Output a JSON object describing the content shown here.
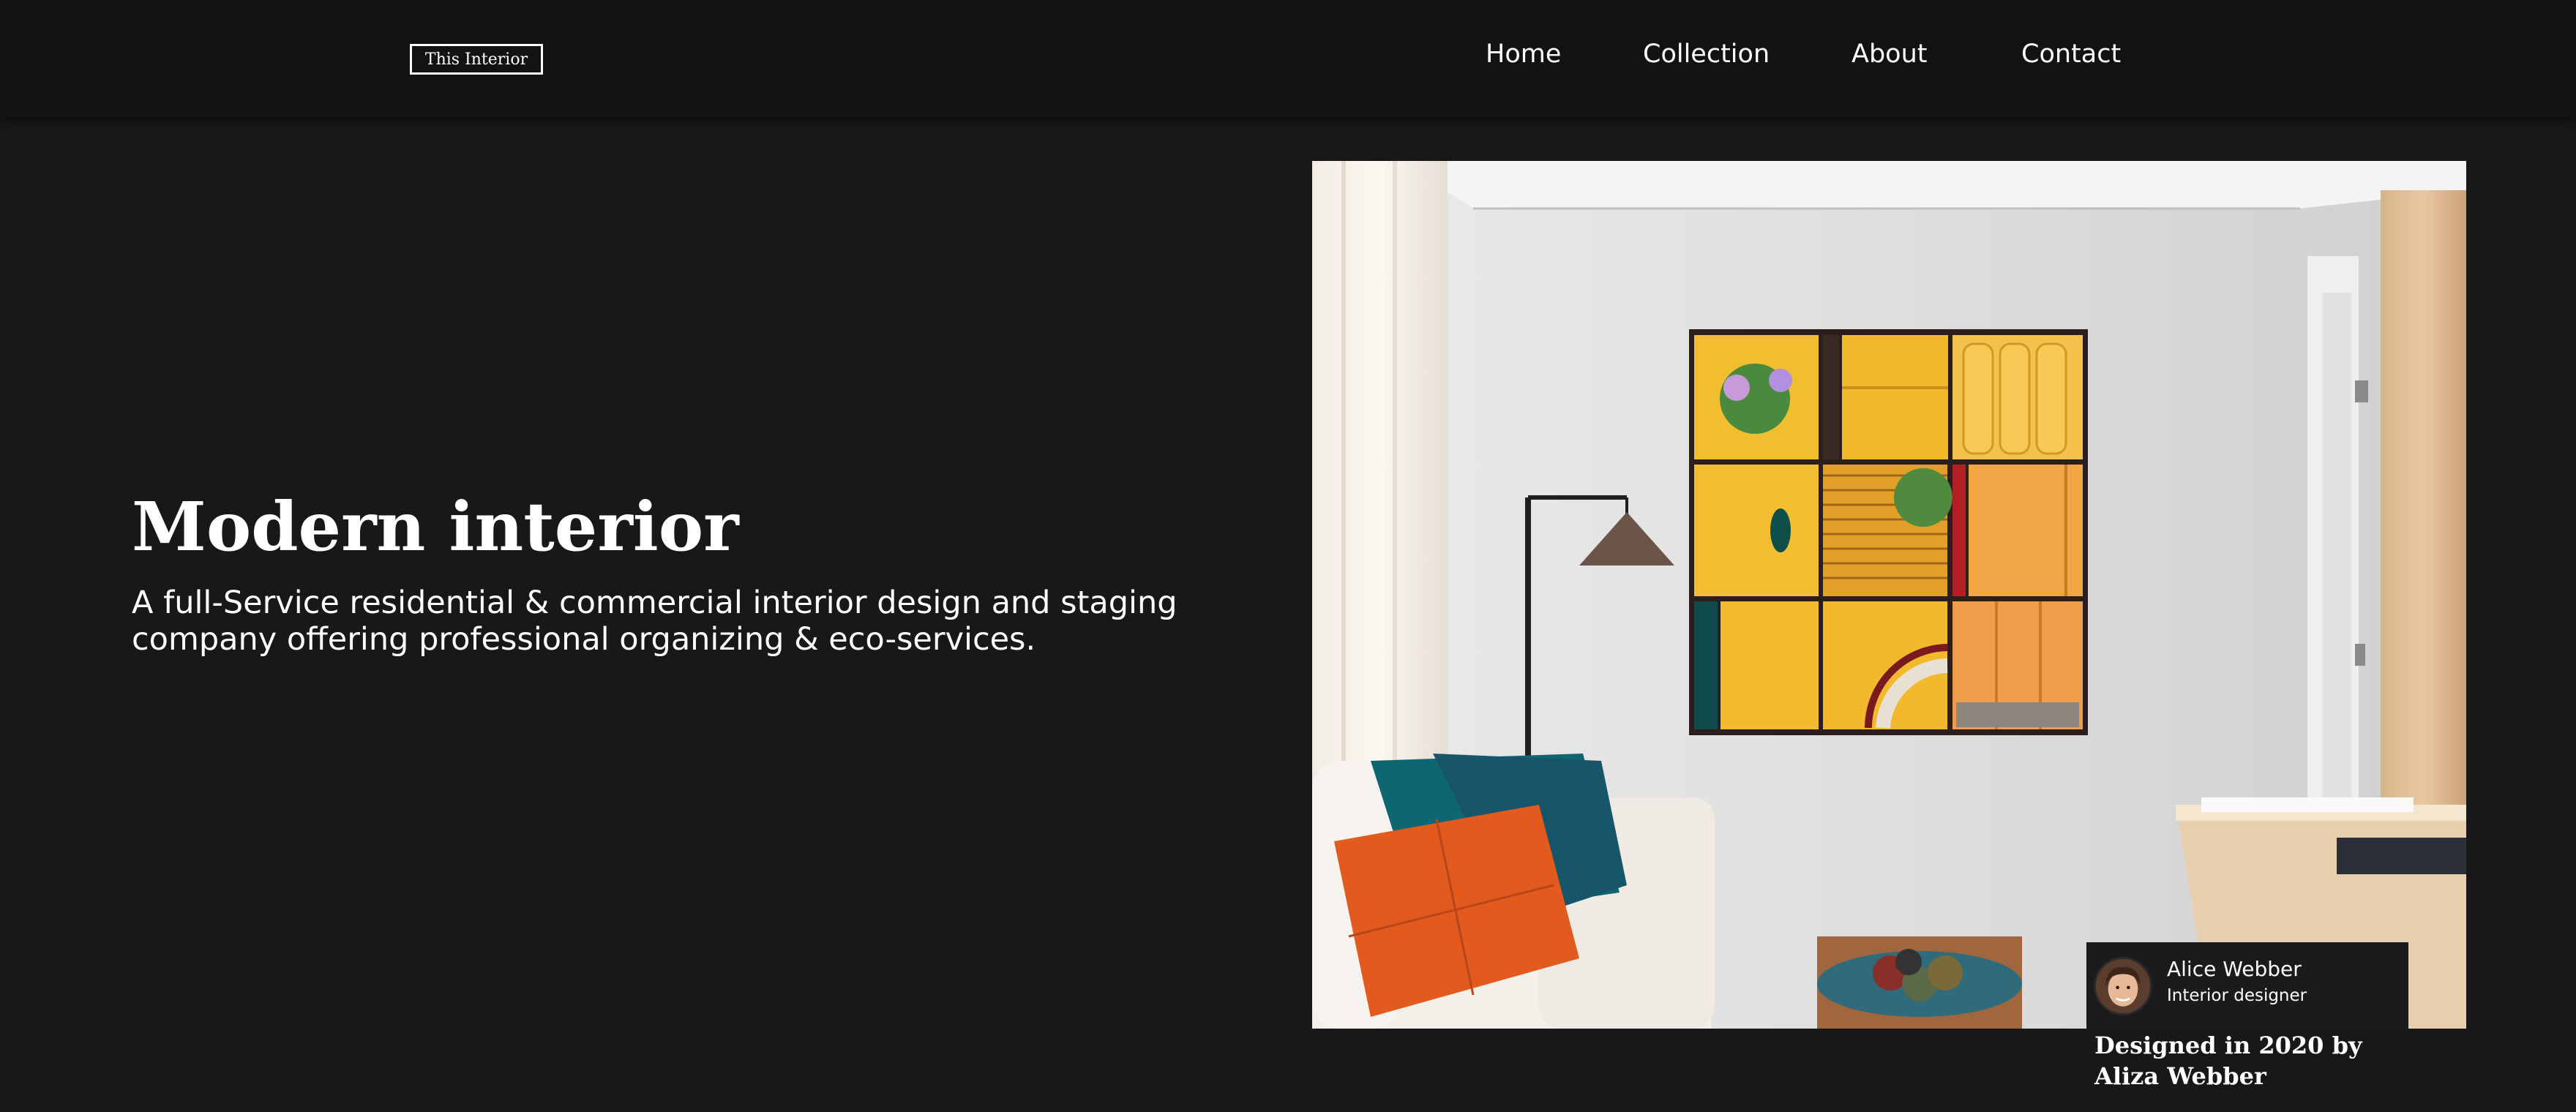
{
  "nav": {
    "logo": "This Interior",
    "links": [
      "Home",
      "Collection",
      "About",
      "Contact"
    ]
  },
  "hero": {
    "title": "Modern interior",
    "description": "A full-Service residential & commercial interior design and staging company offering professional organizing & eco-services."
  },
  "credit": {
    "name": "Alice Webber",
    "role": "Interior designer",
    "footnote": "Designed in 2020 by Aliza Webber"
  },
  "colors": {
    "background": "#18181a",
    "navbar": "#121212",
    "text": "#ffffff"
  }
}
